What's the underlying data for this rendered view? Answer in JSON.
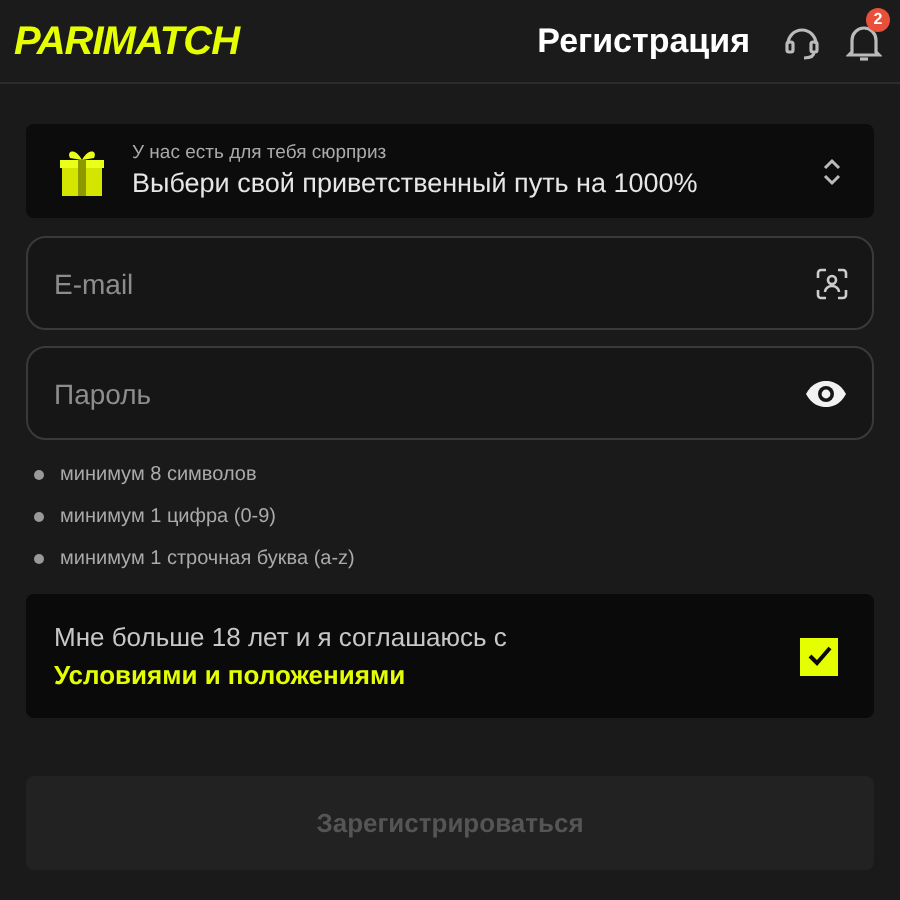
{
  "header": {
    "logo": "PARIMATCH",
    "title": "Регистрация",
    "notification_count": "2"
  },
  "promo": {
    "caption": "У нас есть для тебя сюрприз",
    "title": "Выбери свой приветственный путь на 1000%"
  },
  "fields": [
    {
      "kind": "email",
      "placeholder": "E-mail"
    },
    {
      "kind": "password",
      "placeholder": "Пароль"
    }
  ],
  "password_rules": [
    "минимум 8 символов",
    "минимум 1 цифра (0-9)",
    "минимум 1 строчная буква (a-z)"
  ],
  "terms": {
    "text": "Мне больше 18 лет и я соглашаюсь с",
    "link": "Условиями и положениями",
    "checked": true
  },
  "submit": {
    "label": "Зарегистрироваться",
    "disabled": true
  }
}
